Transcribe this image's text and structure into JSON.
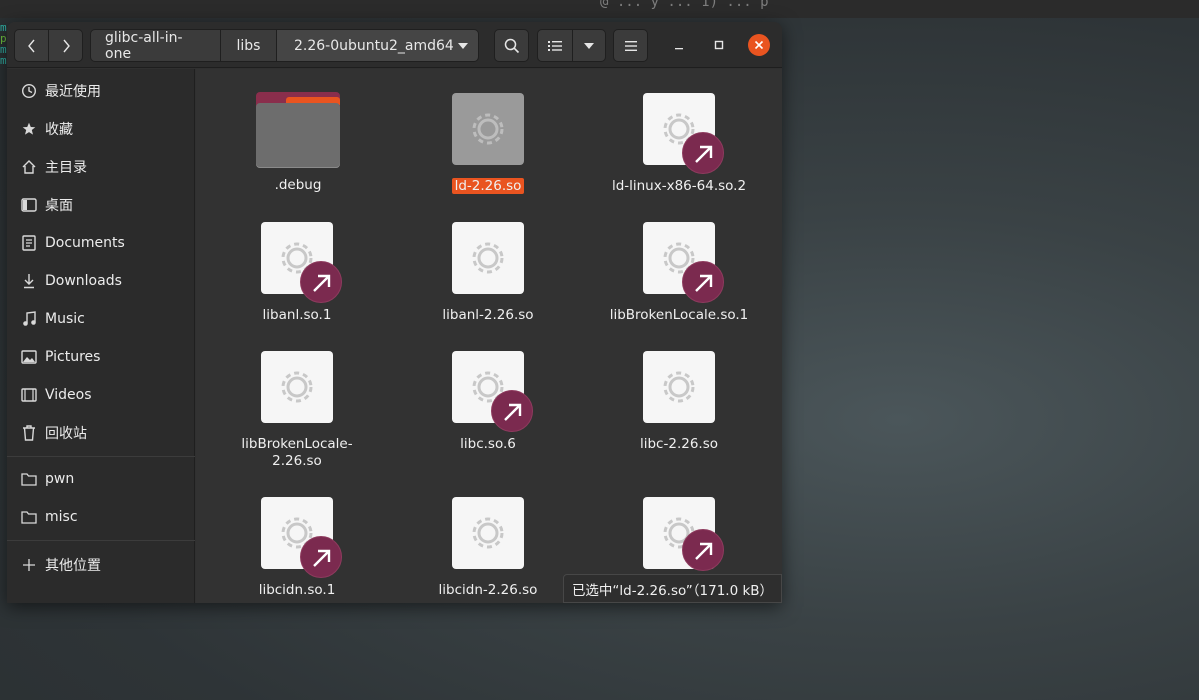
{
  "desktop": {
    "top_text": "@ ... y ... 1) ... p",
    "terminal_edge": [
      "m",
      "p",
      "m",
      "m"
    ]
  },
  "headerbar": {
    "back_icon": "chevron-left-icon",
    "forward_icon": "chevron-right-icon",
    "breadcrumbs": [
      "glibc-all-in-one",
      "libs",
      "2.26-0ubuntu2_amd64"
    ],
    "search_icon": "search-icon",
    "view_icon": "list-view-icon",
    "view_dropdown_icon": "chevron-down-icon",
    "menu_icon": "hamburger-menu-icon",
    "minimize_icon": "minimize-icon",
    "maximize_icon": "maximize-icon",
    "close_icon": "close-icon"
  },
  "sidebar": {
    "items": [
      {
        "label": "最近使用",
        "icon": "clock-icon"
      },
      {
        "label": "收藏",
        "icon": "star-icon"
      },
      {
        "label": "主目录",
        "icon": "home-icon"
      },
      {
        "label": "桌面",
        "icon": "desktop-icon"
      },
      {
        "label": "Documents",
        "icon": "document-icon"
      },
      {
        "label": "Downloads",
        "icon": "download-icon"
      },
      {
        "label": "Music",
        "icon": "music-icon"
      },
      {
        "label": "Pictures",
        "icon": "picture-icon"
      },
      {
        "label": "Videos",
        "icon": "video-icon"
      },
      {
        "label": "回收站",
        "icon": "trash-icon"
      },
      {
        "label": "pwn",
        "icon": "folder-icon"
      },
      {
        "label": "misc",
        "icon": "folder-icon"
      },
      {
        "label": "其他位置",
        "icon": "plus-icon"
      }
    ]
  },
  "files": [
    {
      "name": ".debug",
      "type": "folder",
      "symlink": false,
      "selected": false
    },
    {
      "name": "ld-2.26.so",
      "type": "library",
      "symlink": false,
      "selected": true
    },
    {
      "name": "ld-linux-x86-64.so.2",
      "type": "library",
      "symlink": true,
      "selected": false
    },
    {
      "name": "libanl.so.1",
      "type": "library",
      "symlink": true,
      "selected": false
    },
    {
      "name": "libanl-2.26.so",
      "type": "library",
      "symlink": false,
      "selected": false
    },
    {
      "name": "libBrokenLocale.so.1",
      "type": "library",
      "symlink": true,
      "selected": false
    },
    {
      "name": "libBrokenLocale-\n2.26.so",
      "type": "library",
      "symlink": false,
      "selected": false
    },
    {
      "name": "libc.so.6",
      "type": "library",
      "symlink": true,
      "selected": false
    },
    {
      "name": "libc-2.26.so",
      "type": "library",
      "symlink": false,
      "selected": false
    },
    {
      "name": "libcidn.so.1",
      "type": "library",
      "symlink": true,
      "selected": false
    },
    {
      "name": "libcidn-2.26.so",
      "type": "library",
      "symlink": false,
      "selected": false
    },
    {
      "name": "",
      "type": "library",
      "symlink": true,
      "selected": false
    }
  ],
  "status": "已选中“ld-2.26.so”（171.0 kB）",
  "colors": {
    "accent": "#e95420",
    "symlink_badge": "#7b2a4f",
    "folder": "#8a2e4c"
  }
}
